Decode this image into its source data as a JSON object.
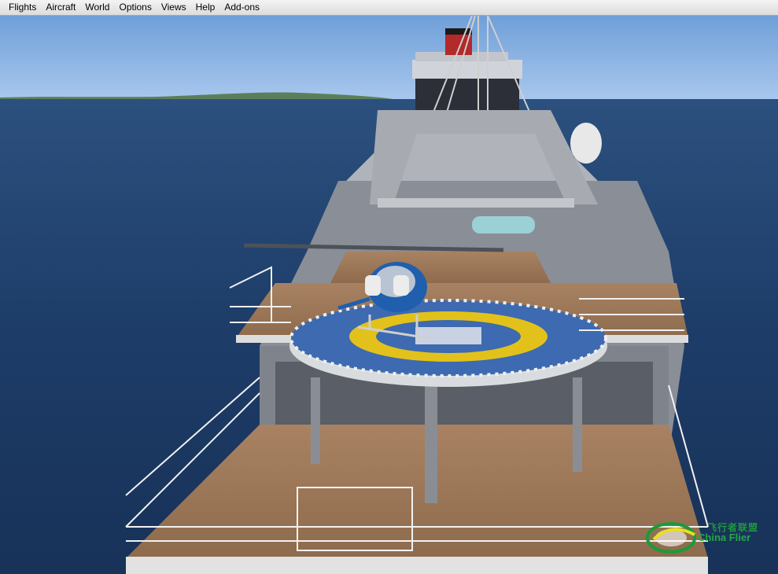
{
  "menu": {
    "items": [
      {
        "label": "Flights"
      },
      {
        "label": "Aircraft"
      },
      {
        "label": "World"
      },
      {
        "label": "Options"
      },
      {
        "label": "Views"
      },
      {
        "label": "Help"
      },
      {
        "label": "Add-ons"
      }
    ]
  },
  "watermark": {
    "chinese": "飞行者联盟",
    "english": "China Flier"
  },
  "colors": {
    "sky": "#8fb8e8",
    "sea": "#1f3f6d",
    "deck": "#9b7757",
    "hull": "#d4d6da",
    "helipad_ring": "#e2c21a",
    "helicopter": "#1f5fae",
    "watermark": "#22a844"
  }
}
